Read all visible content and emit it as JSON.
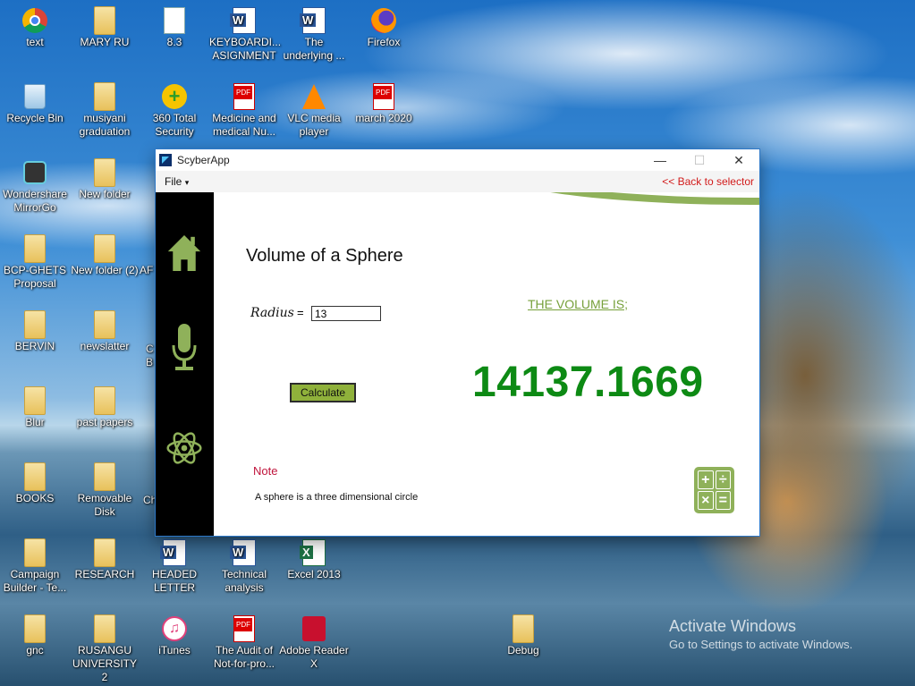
{
  "desktop": {
    "icons": [
      {
        "label": "text",
        "kind": "chrome"
      },
      {
        "label": "MARY RU",
        "kind": "folder"
      },
      {
        "label": "8.3",
        "kind": "doc"
      },
      {
        "label": "KEYBOARDI... ASIGNMENT",
        "kind": "word"
      },
      {
        "label": "The underlying ...",
        "kind": "word"
      },
      {
        "label": "Firefox",
        "kind": "firefox"
      },
      {
        "label": "Recycle Bin",
        "kind": "recycle"
      },
      {
        "label": "musiyani graduation",
        "kind": "folder"
      },
      {
        "label": "360 Total Security",
        "kind": "security"
      },
      {
        "label": "Medicine and medical Nu...",
        "kind": "pdf"
      },
      {
        "label": "VLC media player",
        "kind": "vlc"
      },
      {
        "label": "march 2020",
        "kind": "pdf"
      },
      {
        "label": "Wondershare MirrorGo",
        "kind": "mirror"
      },
      {
        "label": "New folder",
        "kind": "folder"
      },
      {
        "label": "BCP-GHETS Proposal",
        "kind": "folder"
      },
      {
        "label": "New folder (2)",
        "kind": "folder"
      },
      {
        "label": "AF",
        "kind": "folder"
      },
      {
        "label": "BERVIN",
        "kind": "folder"
      },
      {
        "label": "newslatter",
        "kind": "folder"
      },
      {
        "label": "C B",
        "kind": "folder"
      },
      {
        "label": "Blur",
        "kind": "folder"
      },
      {
        "label": "past papers",
        "kind": "folder"
      },
      {
        "label": "BOOKS",
        "kind": "folder"
      },
      {
        "label": "Removable Disk",
        "kind": "folder"
      },
      {
        "label": "Ch",
        "kind": "folder"
      },
      {
        "label": "Campaign Builder - Te...",
        "kind": "folder"
      },
      {
        "label": "RESEARCH",
        "kind": "folder"
      },
      {
        "label": "HEADED LETTER",
        "kind": "word"
      },
      {
        "label": "Technical analysis",
        "kind": "word"
      },
      {
        "label": "Excel 2013",
        "kind": "excel"
      },
      {
        "label": "gnc",
        "kind": "folder"
      },
      {
        "label": "RUSANGU UNIVERSITY 2",
        "kind": "folder"
      },
      {
        "label": "iTunes",
        "kind": "itunes"
      },
      {
        "label": "The Audit of Not-for-pro...",
        "kind": "pdf"
      },
      {
        "label": "Adobe Reader X",
        "kind": "pdf"
      },
      {
        "label": "Debug",
        "kind": "folder"
      }
    ]
  },
  "window": {
    "title": "ScyberApp",
    "minimize": "—",
    "maximize": "☐",
    "close": "✕",
    "menu_file": "File",
    "menu_file_arrow": "▾",
    "back_link": "<< Back to selector"
  },
  "sidebar": {
    "items": [
      {
        "icon": "home-icon"
      },
      {
        "icon": "microphone-icon"
      },
      {
        "icon": "atom-icon"
      }
    ]
  },
  "main": {
    "heading": "Volume of a Sphere",
    "radius_label": "Radius",
    "equals": "=",
    "radius_value": "13",
    "calculate_label": "Calculate",
    "volume_label": "THE VOLUME IS;",
    "result": "14137.1669",
    "note_label": "Note",
    "note_text": "A sphere is a three dimensional circle",
    "calc_icon_symbols": [
      "+",
      "÷",
      "×",
      "="
    ]
  },
  "watermark": {
    "line1": "Activate Windows",
    "line2": "Go to Settings to activate Windows."
  },
  "colors": {
    "accent_green": "#8fb15a",
    "result_green": "#0d8a14",
    "back_link_red": "#d21b1b",
    "note_red": "#c0143c"
  }
}
